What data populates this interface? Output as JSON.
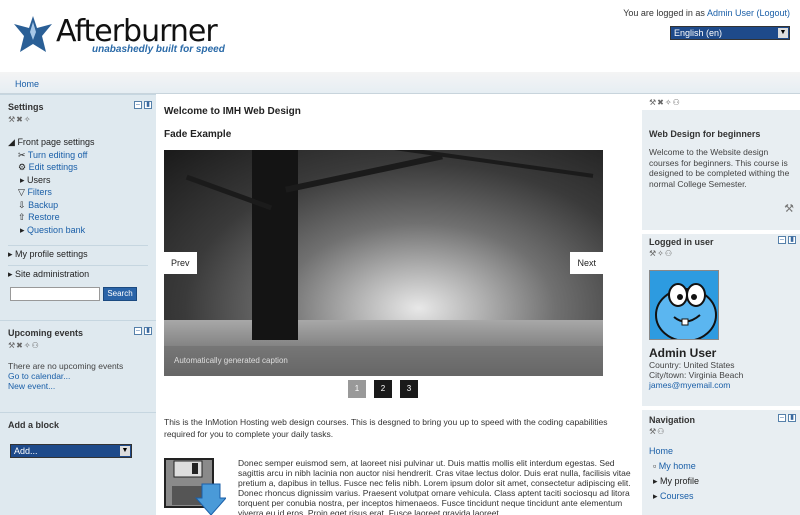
{
  "header": {
    "site_title": "Afterburner",
    "tagline": "unabashedly built for speed",
    "login_prefix": "You are logged in as ",
    "login_user": "Admin User",
    "logout": "(Logout)",
    "language": "English (en)"
  },
  "nav": {
    "home": "Home"
  },
  "settings": {
    "title": "Settings",
    "front_page": "Front page settings",
    "items": [
      "Turn editing off",
      "Edit settings",
      "Users",
      "Filters",
      "Backup",
      "Restore",
      "Question bank"
    ],
    "my_profile": "My profile settings",
    "site_admin": "Site administration",
    "search_btn": "Search"
  },
  "upcoming": {
    "title": "Upcoming events",
    "none": "There are no upcoming events",
    "calendar": "Go to calendar...",
    "new_event": "New event..."
  },
  "add_block": {
    "title": "Add a block",
    "select": "Add..."
  },
  "main": {
    "welcome": "Welcome to IMH Web Design",
    "fade_title": "Fade Example",
    "prev": "Prev",
    "next": "Next",
    "caption": "Automatically generated caption",
    "pages": [
      "1",
      "2",
      "3"
    ],
    "intro": "This is the InMotion Hosting web design courses. This is desgned to bring you up to speed with the coding capabilities required for you to complete your daily tasks.",
    "lorem": "Donec semper euismod sem, at laoreet nisi pulvinar ut. Duis mattis mollis elit interdum egestas. Sed sagittis arcu in nibh lacinia non auctor nisi hendrerit. Cras vitae lectus dolor. Duis erat nulla, facilisis vitae pretium a, dapibus in tellus. Fusce nec felis nibh. Lorem ipsum dolor sit amet, consectetur adipiscing elit. Donec rhoncus dignissim varius. Praesent volutpat ornare vehicula. Class aptent taciti sociosqu ad litora torquent per conubia nostra, per inceptos himenaeos. Fusce tincidunt neque tincidunt ante elementum viverra eu id eros. Proin eget risus erat. Fusce laoreet gravida laoreet."
  },
  "right": {
    "wd_title": "Web Design for beginners",
    "wd_text": "Welcome to the Website design courses for beginners. This course is designed to be completed withing the normal College Semester.",
    "logged_title": "Logged in user",
    "user_name": "Admin User",
    "country": "Country: United States",
    "city": "City/town: Virginia Beach",
    "email": "james@myemail.com",
    "nav_title": "Navigation",
    "nav_items": [
      "Home",
      "My home",
      "My profile",
      "Courses"
    ]
  },
  "colors": {
    "accent": "#1a5fa8",
    "sidebar": "#dfe9ef",
    "pager_active": "#999999",
    "pager": "#1a1a1a"
  }
}
